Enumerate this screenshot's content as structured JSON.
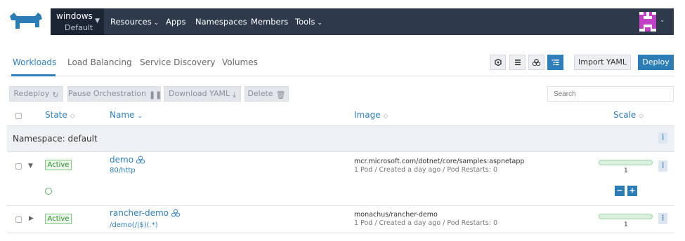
{
  "header": {
    "cluster_name": "windows",
    "project_name": "Default",
    "nav": [
      {
        "label": "Resources",
        "dropdown": true
      },
      {
        "label": "Apps",
        "dropdown": false
      },
      {
        "label": "Namespaces",
        "dropdown": false
      },
      {
        "label": "Members",
        "dropdown": false
      },
      {
        "label": "Tools",
        "dropdown": true
      }
    ]
  },
  "tabs": [
    "Workloads",
    "Load Balancing",
    "Service Discovery",
    "Volumes"
  ],
  "active_tab": "Workloads",
  "view_buttons": [
    "node-icon",
    "list-icon",
    "group-icon",
    "tree-icon"
  ],
  "toolbar": {
    "import_label": "Import YAML",
    "deploy_label": "Deploy"
  },
  "actions": {
    "redeploy": "Redeploy",
    "pause": "Pause Orchestration",
    "download": "Download YAML",
    "delete": "Delete"
  },
  "search": {
    "placeholder": "Search"
  },
  "columns": {
    "state": "State",
    "name": "Name",
    "image": "Image",
    "scale": "Scale"
  },
  "namespace_group": {
    "label": "Namespace: default"
  },
  "workloads": [
    {
      "state": "Active",
      "name": "demo",
      "endpoint": "80/http",
      "image": "mcr.microsoft.com/dotnet/core/samples:aspnetapp",
      "details": "1 Pod / Created a day ago / Pod Restarts: 0",
      "scale": "1",
      "expanded": true
    },
    {
      "state": "Active",
      "name": "rancher-demo",
      "endpoint": "/demo(/|$)(.*)",
      "image": "monachus/rancher-demo",
      "details": "1 Pod / Created a day ago / Pod Restarts: 0",
      "scale": "1",
      "expanded": false
    }
  ],
  "colors": {
    "navbar": "#2e3a4c",
    "accent": "#2f7fbd",
    "active_badge": "#2e8a2e"
  }
}
